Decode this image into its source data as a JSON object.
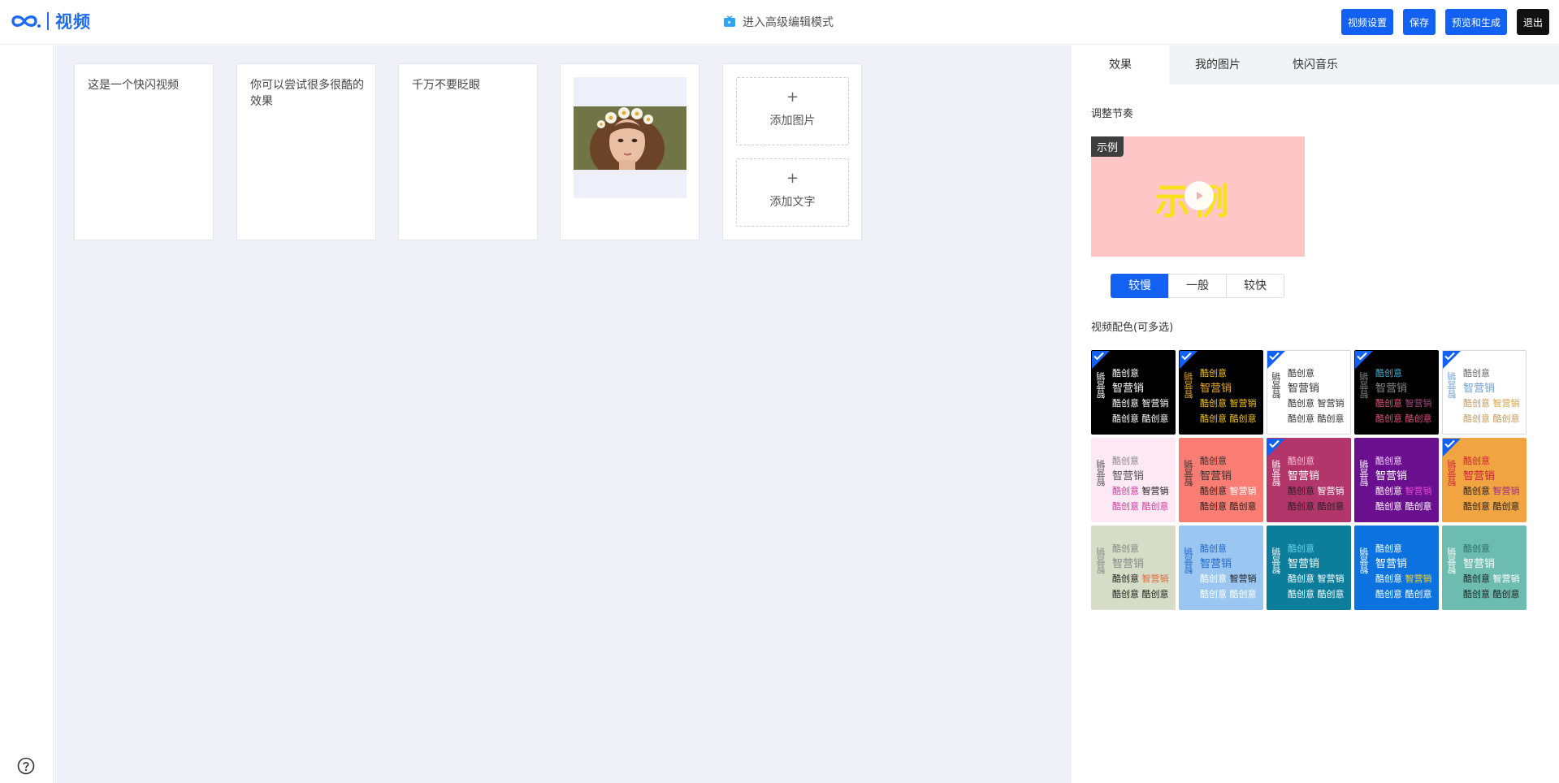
{
  "header": {
    "logo_text": "视频",
    "advanced_mode": "进入高级编辑模式",
    "buttons": {
      "settings": "视频设置",
      "save": "保存",
      "preview": "预览和生成",
      "exit": "退出"
    }
  },
  "canvas": {
    "cards": [
      {
        "text": "这是一个快闪视频"
      },
      {
        "text": "你可以尝试很多很酷的效果"
      },
      {
        "text": "千万不要眨眼"
      }
    ],
    "add_image": "添加图片",
    "add_text": "添加文字",
    "plus": "+"
  },
  "panel": {
    "tabs": [
      "效果",
      "我的图片",
      "快闪音乐"
    ],
    "rhythm_label": "调整节奏",
    "demo_tag": "示例",
    "demo_word": "示例",
    "speeds": [
      "较慢",
      "一般",
      "较快"
    ],
    "palette_label": "视频配色(可多选)",
    "palette_words": {
      "vertical": "智营销",
      "line1": "酷创意",
      "line2": "智营销",
      "line3a": "酷创意",
      "line3b": "智营销",
      "line4a": "酷创意",
      "line4b": "酷创意"
    },
    "palettes": [
      {
        "bg": "#000000",
        "c": [
          "#ffffff",
          "#ffffff",
          "#ffffff",
          "#ffffff"
        ],
        "checked": true
      },
      {
        "bg": "#000000",
        "c": [
          "#f5c518",
          "#e7a822",
          "#f5c518",
          "#f5c518"
        ],
        "checked": true
      },
      {
        "bg": "#ffffff",
        "c": [
          "#333333",
          "#333333",
          "#333333",
          "#333333"
        ],
        "checked": true
      },
      {
        "bg": "#000000",
        "c": [
          "#3fb0d8",
          "#888888",
          "#a14b7f",
          "#e54b7f"
        ],
        "checked": true
      },
      {
        "bg": "#ffffff",
        "c": [
          "#666666",
          "#6ea0d8",
          "#d8a345",
          "#c89a5a"
        ],
        "checked": true
      },
      {
        "bg": "#fde9f3",
        "c": [
          "#888888",
          "#555555",
          "#222222",
          "#d33aa3"
        ],
        "checked": false
      },
      {
        "bg": "#fa7d73",
        "c": [
          "#333333",
          "#333333",
          "#ffffff",
          "#222222"
        ],
        "checked": false
      },
      {
        "bg": "#b3366b",
        "c": [
          "#f3c2d4",
          "#ffffff",
          "#ffffff",
          "#222222"
        ],
        "checked": true
      },
      {
        "bg": "#6a0f8e",
        "c": [
          "#f2d4ff",
          "#ffffff",
          "#e54bd0",
          "#ffffff"
        ],
        "checked": false
      },
      {
        "bg": "#f0a542",
        "c": [
          "#d11f3a",
          "#d11f3a",
          "#9e2a86",
          "#222222"
        ],
        "checked": true
      },
      {
        "bg": "#d6dcc6",
        "c": [
          "#888888",
          "#888888",
          "#e1683a",
          "#222222"
        ],
        "checked": false
      },
      {
        "bg": "#9cc6f2",
        "c": [
          "#1e67c8",
          "#1e67c8",
          "#222222",
          "#ffffff"
        ],
        "checked": false
      },
      {
        "bg": "#0d7d9c",
        "c": [
          "#6ad2e6",
          "#ffffff",
          "#ffffff",
          "#ffffff"
        ],
        "checked": false
      },
      {
        "bg": "#0b72e0",
        "c": [
          "#ffffff",
          "#ffffff",
          "#f5d327",
          "#ffffff"
        ],
        "checked": false
      },
      {
        "bg": "#6dbcb0",
        "c": [
          "#2c6f66",
          "#ffffff",
          "#ffffff",
          "#222222"
        ],
        "checked": false
      }
    ]
  },
  "colors": {
    "accent": "#1361f2",
    "canvas_bg": "#eff0f8"
  }
}
